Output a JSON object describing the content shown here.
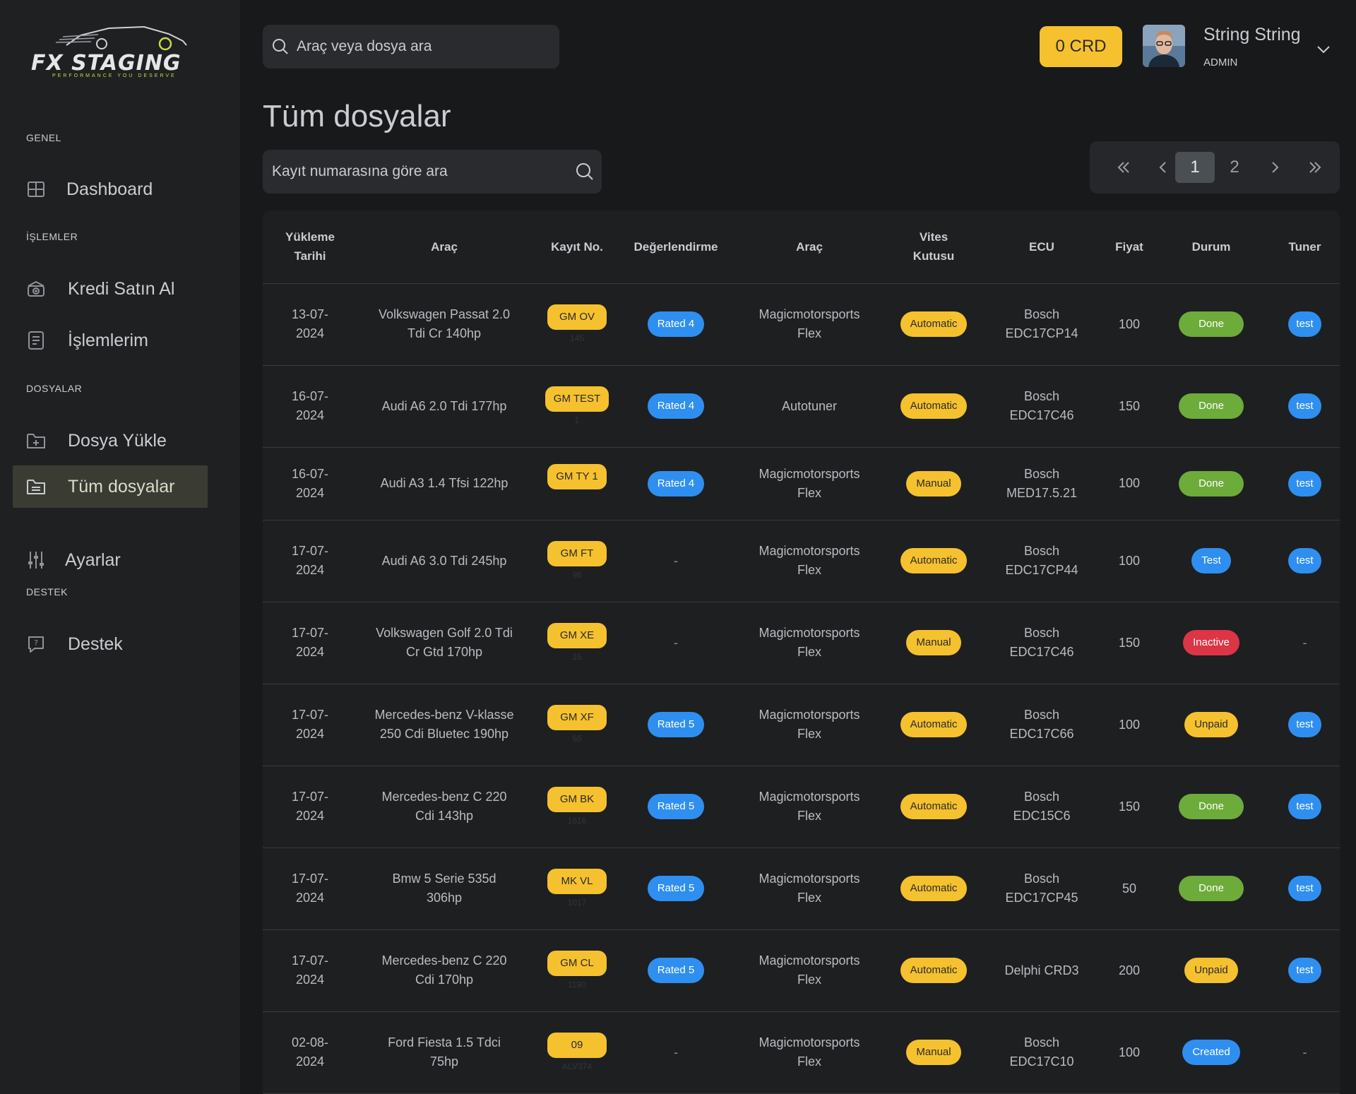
{
  "app": {
    "logo_text": "FX STAGING",
    "logo_tagline": "PERFORMANCE YOU DESERVE"
  },
  "sidebar": {
    "sections": {
      "genel": "GENEL",
      "islemler": "İŞLEMLER",
      "dosyalar": "DOSYALAR",
      "destek": "DESTEK"
    },
    "items": [
      {
        "label": "Dashboard",
        "icon": "dashboard-icon"
      },
      {
        "label": "Kredi Satın Al",
        "icon": "credit-icon"
      },
      {
        "label": "İşlemlerim",
        "icon": "receipt-icon"
      },
      {
        "label": "Dosya Yükle",
        "icon": "folder-upload-icon"
      },
      {
        "label": "Tüm dosyalar",
        "icon": "files-icon",
        "active": true
      },
      {
        "label": "Ayarlar",
        "icon": "sliders-icon"
      },
      {
        "label": "Destek",
        "icon": "support-icon"
      }
    ]
  },
  "header": {
    "search_placeholder": "Araç veya dosya ara",
    "credits": "0 CRD",
    "user_name": "String String",
    "user_role": "ADMIN"
  },
  "page": {
    "title": "Tüm dosyalar",
    "record_search_placeholder": "Kayıt numarasına göre ara"
  },
  "pagination": {
    "first": "«",
    "prev": "‹",
    "pages": [
      "1",
      "2"
    ],
    "current": "1",
    "next": "›",
    "last": "»"
  },
  "table": {
    "headers": [
      "Yükleme Tarihi",
      "Araç",
      "Kayıt No.",
      "Değerlendirme",
      "Araç",
      "Vites Kutusu",
      "ECU",
      "Fiyat",
      "Durum",
      "Tuner"
    ],
    "rows": [
      {
        "date": "13-07-2024",
        "vehicle": "Volkswagen Passat 2.0 Tdi Cr 140hp",
        "plate": "GM OV",
        "plate_sub": "145",
        "rating": "Rated 4",
        "tool": "Magicmotorsports Flex",
        "gearbox": "Automatic",
        "ecu": "Bosch EDC17CP14",
        "price": "100",
        "status": "Done",
        "status_color": "green",
        "tuner": "test"
      },
      {
        "date": "16-07-2024",
        "vehicle": "Audi A6 2.0 Tdi 177hp",
        "plate": "GM TEST",
        "plate_sub": "1",
        "rating": "Rated 4",
        "tool": "Autotuner",
        "gearbox": "Automatic",
        "ecu": "Bosch EDC17C46",
        "price": "150",
        "status": "Done",
        "status_color": "green",
        "tuner": "test"
      },
      {
        "date": "16-07-2024",
        "vehicle": "Audi A3 1.4 Tfsi 122hp",
        "plate": "GM TY 1",
        "plate_sub": "",
        "rating": "Rated 4",
        "tool": "Magicmotorsports Flex",
        "gearbox": "Manual",
        "ecu": "Bosch MED17.5.21",
        "price": "100",
        "status": "Done",
        "status_color": "green",
        "tuner": "test"
      },
      {
        "date": "17-07-2024",
        "vehicle": "Audi A6 3.0 Tdi 245hp",
        "plate": "GM FT",
        "plate_sub": "96",
        "rating": "-",
        "tool": "Magicmotorsports Flex",
        "gearbox": "Automatic",
        "ecu": "Bosch EDC17CP44",
        "price": "100",
        "status": "Test",
        "status_color": "blue",
        "tuner": "test"
      },
      {
        "date": "17-07-2024",
        "vehicle": "Volkswagen Golf 2.0 Tdi Cr Gtd 170hp",
        "plate": "GM XE",
        "plate_sub": "15",
        "rating": "-",
        "tool": "Magicmotorsports Flex",
        "gearbox": "Manual",
        "ecu": "Bosch EDC17C46",
        "price": "150",
        "status": "Inactive",
        "status_color": "red",
        "tuner": "-"
      },
      {
        "date": "17-07-2024",
        "vehicle": "Mercedes-benz V-klasse 250 Cdi Bluetec 190hp",
        "plate": "GM XF",
        "plate_sub": "55",
        "rating": "Rated 5",
        "tool": "Magicmotorsports Flex",
        "gearbox": "Automatic",
        "ecu": "Bosch EDC17C66",
        "price": "100",
        "status": "Unpaid",
        "status_color": "yellow",
        "tuner": "test"
      },
      {
        "date": "17-07-2024",
        "vehicle": "Mercedes-benz C 220 Cdi 143hp",
        "plate": "GM BK",
        "plate_sub": "1616",
        "rating": "Rated 5",
        "tool": "Magicmotorsports Flex",
        "gearbox": "Automatic",
        "ecu": "Bosch EDC15C6",
        "price": "150",
        "status": "Done",
        "status_color": "green",
        "tuner": "test"
      },
      {
        "date": "17-07-2024",
        "vehicle": "Bmw 5 Serie 535d 306hp",
        "plate": "MK VL",
        "plate_sub": "1017",
        "rating": "Rated 5",
        "tool": "Magicmotorsports Flex",
        "gearbox": "Automatic",
        "ecu": "Bosch EDC17CP45",
        "price": "50",
        "status": "Done",
        "status_color": "green",
        "tuner": "test"
      },
      {
        "date": "17-07-2024",
        "vehicle": "Mercedes-benz C 220 Cdi 170hp",
        "plate": "GM CL",
        "plate_sub": "1190",
        "rating": "Rated 5",
        "tool": "Magicmotorsports Flex",
        "gearbox": "Automatic",
        "ecu": "Delphi CRD3",
        "price": "200",
        "status": "Unpaid",
        "status_color": "yellow",
        "tuner": "test"
      },
      {
        "date": "02-08-2024",
        "vehicle": "Ford Fiesta 1.5 Tdci 75hp",
        "plate": "09",
        "plate_sub": "ALV374",
        "rating": "-",
        "tool": "Magicmotorsports Flex",
        "gearbox": "Manual",
        "ecu": "Bosch EDC17C10",
        "price": "100",
        "status": "Created",
        "status_color": "blue",
        "tuner": "-"
      }
    ]
  },
  "colors": {
    "accent_yellow": "#f5c12e",
    "accent_blue": "#2f8ff0",
    "status_green": "#6dab3b",
    "status_red": "#dc3545",
    "background": "#18191b",
    "sidebar": "#1f2022"
  }
}
